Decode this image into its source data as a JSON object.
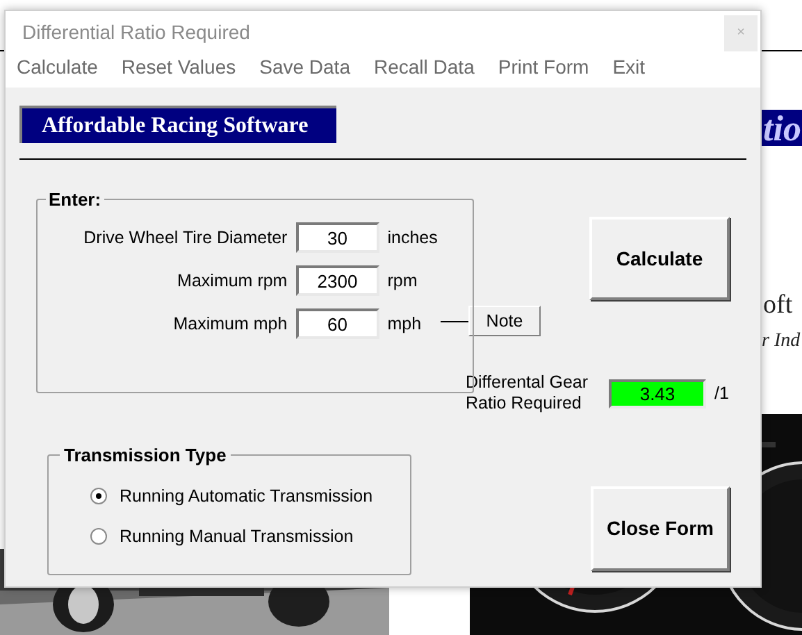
{
  "background": {
    "banner_fragment": "tio",
    "line_1": "oft",
    "line_2": "r Ind"
  },
  "window": {
    "title": "Differential Ratio Required",
    "close": "×"
  },
  "menu": [
    "Calculate",
    "Reset Values",
    "Save Data",
    "Recall Data",
    "Print Form",
    "Exit"
  ],
  "banner": "Affordable Racing Software",
  "enter_group": {
    "title": "Enter:",
    "fields": [
      {
        "label": "Drive Wheel Tire Diameter",
        "value": "30",
        "unit": "inches"
      },
      {
        "label": "Maximum rpm",
        "value": "2300",
        "unit": "rpm"
      },
      {
        "label": "Maximum mph",
        "value": "60",
        "unit": "mph"
      }
    ]
  },
  "calculate_button": "Calculate",
  "note_button": "Note",
  "result": {
    "label": "Differental Gear Ratio Required",
    "value": "3.43",
    "unit": "/1"
  },
  "transmission_group": {
    "title": "Transmission Type",
    "options": [
      {
        "label": "Running Automatic Transmission",
        "selected": true
      },
      {
        "label": "Running Manual Transmission",
        "selected": false
      }
    ]
  },
  "close_button": "Close Form"
}
